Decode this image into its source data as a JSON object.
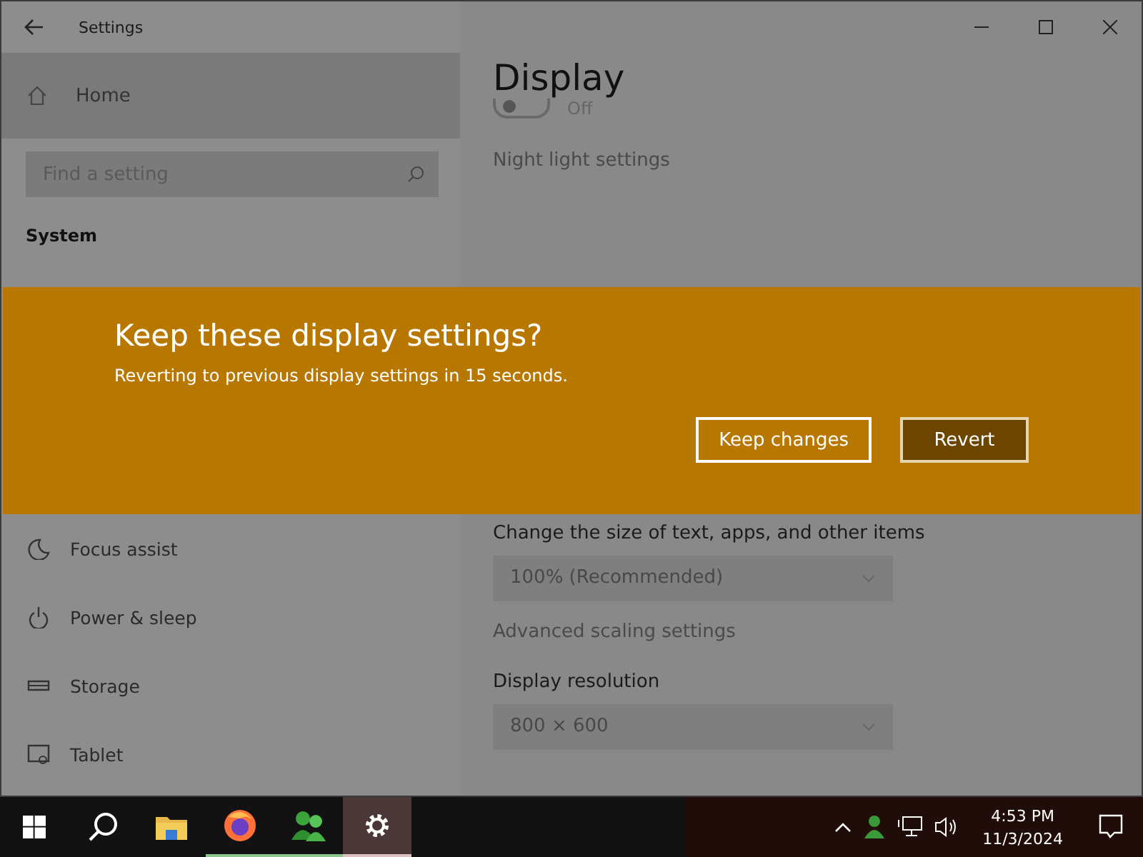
{
  "window": {
    "title": "Settings"
  },
  "sidebar": {
    "home": "Home",
    "search": {
      "placeholder": "Find a setting"
    },
    "section": "System",
    "items": [
      {
        "label": "Focus assist",
        "kind": "moon"
      },
      {
        "label": "Power & sleep",
        "kind": "power"
      },
      {
        "label": "Storage",
        "kind": "storage"
      },
      {
        "label": "Tablet",
        "kind": "tablet"
      }
    ]
  },
  "page": {
    "title": "Display",
    "night_light": {
      "on": false,
      "state": "Off"
    },
    "night_light_link": "Night light settings",
    "scale_label": "Change the size of text, apps, and other items",
    "scale_dropdown": {
      "value": "100% (Recommended)",
      "disabled": true
    },
    "advanced_link": "Advanced scaling settings",
    "resolution_label": "Display resolution",
    "resolution_dropdown": {
      "value": "800 × 600",
      "disabled": true
    }
  },
  "dialog": {
    "title": "Keep these display settings?",
    "message": "Reverting to previous display settings in 15 seconds.",
    "buttons": [
      {
        "label": "Keep changes",
        "kind": "focused"
      },
      {
        "label": "Revert",
        "kind": "filled"
      }
    ]
  },
  "taskbar": {
    "apps": [
      {
        "kind": "explorer",
        "running": false,
        "selected": false
      },
      {
        "kind": "firefox",
        "running": true,
        "selected": false
      },
      {
        "kind": "people",
        "running": true,
        "selected": false
      },
      {
        "kind": "settings",
        "running": true,
        "selected": true
      }
    ],
    "time": "4:53 PM",
    "date": "11/3/2024"
  }
}
